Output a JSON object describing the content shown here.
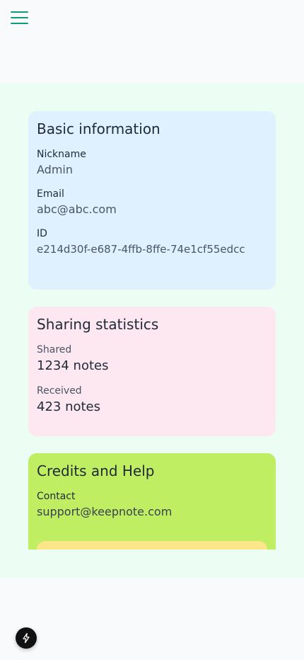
{
  "header": {
    "menu_icon": "hamburger-menu-icon",
    "menu_color": "#0f9b7a"
  },
  "basic_info": {
    "title": "Basic information",
    "nickname_label": "Nickname",
    "nickname_value": "Admin",
    "email_label": "Email",
    "email_value": "abc@abc.com",
    "id_label": "ID",
    "id_value": "e214d30f-e687-4ffb-8ffe-74e1cf55edcc"
  },
  "sharing": {
    "title": "Sharing statistics",
    "shared_label": "Shared",
    "shared_value": "1234 notes",
    "received_label": "Received",
    "received_value": "423 notes"
  },
  "credits": {
    "title": "Credits and Help",
    "contact_label": "Contact",
    "contact_value": "support@keepnote.com"
  },
  "fab": {
    "icon": "lightning-bolt-icon"
  },
  "colors": {
    "page_background": "#f8fafc",
    "main_background": "#ecfdf3",
    "basic_card": "#dff1fe",
    "sharing_card": "#fde8f2",
    "credits_card": "#c0ee63",
    "help_box": "#fde68a"
  }
}
